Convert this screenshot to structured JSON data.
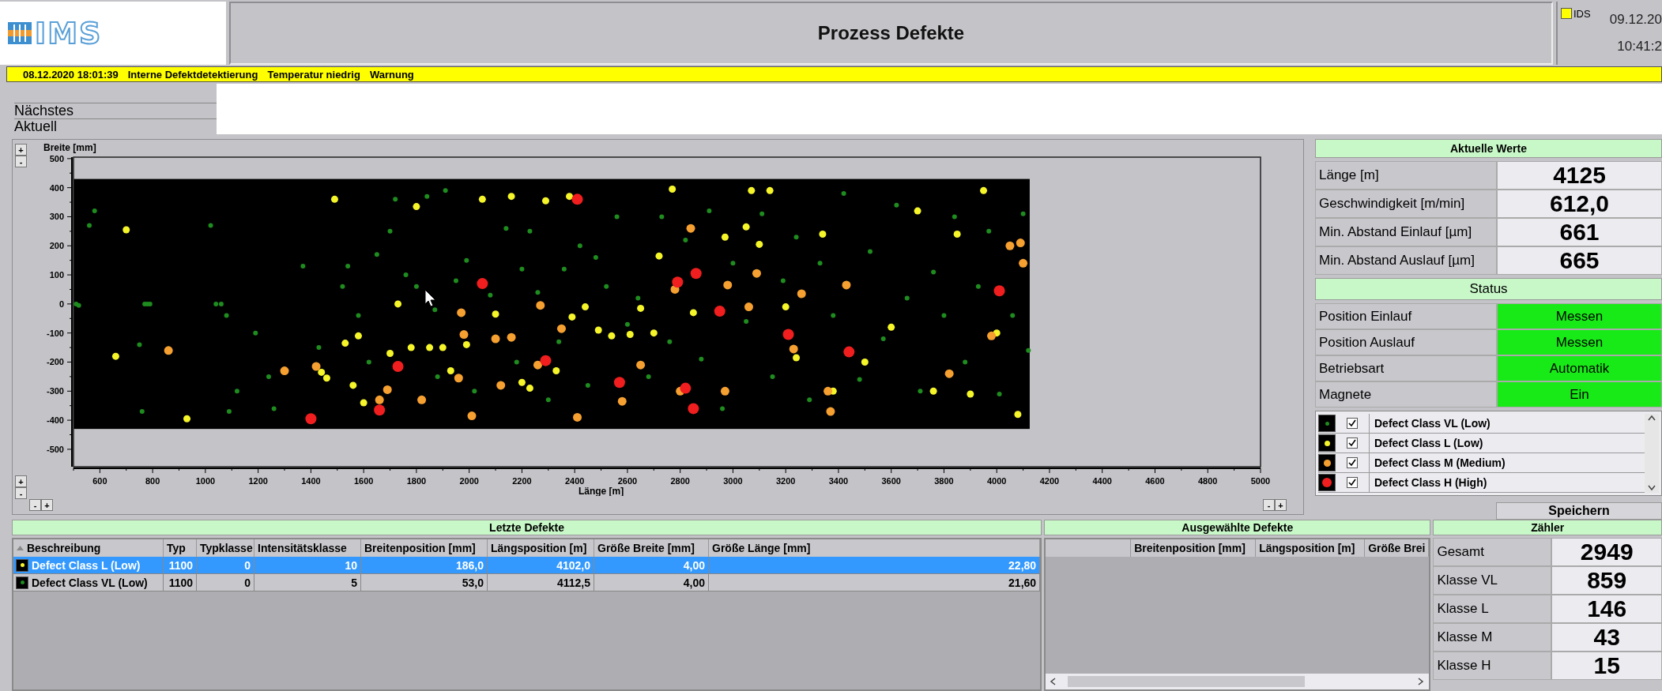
{
  "logo": {
    "text": "IMS"
  },
  "header": {
    "title": "Prozess Defekte",
    "indicator": {
      "label": "IDS",
      "on": true
    },
    "date": "09.12.20",
    "time": "10:41:2"
  },
  "alarm_bar": {
    "items": [
      "08.12.2020 18:01:39",
      "Interne Defektdetektierung",
      "Temperatur niedrig",
      "Warnung"
    ]
  },
  "schedule": {
    "rows": [
      "Nächstes",
      "Aktuell"
    ]
  },
  "chart": {
    "zoom_buttons": {
      "y_top": [
        "+",
        "-"
      ],
      "y_bottom": [
        "+",
        "-"
      ],
      "x_left": [
        "-",
        "+"
      ],
      "x_right": [
        "-",
        "+"
      ]
    },
    "chart_data": {
      "type": "scatter",
      "xlabel": "Länge [m]",
      "ylabel": "Breite [mm]",
      "xlim": [
        500,
        5000
      ],
      "ylim": [
        -560,
        505
      ],
      "xticks": [
        600,
        800,
        1000,
        1200,
        1400,
        1600,
        1800,
        2000,
        2200,
        2400,
        2600,
        2800,
        3000,
        3200,
        3400,
        3600,
        3800,
        4000,
        4200,
        4400,
        4600,
        4800,
        5000
      ],
      "yticks": [
        -500,
        -400,
        -300,
        -200,
        -100,
        0,
        100,
        200,
        300,
        400,
        500
      ],
      "bands": [
        {
          "axis": "y",
          "from": 430,
          "to": 505
        },
        {
          "axis": "y",
          "from": -560,
          "to": -430
        },
        {
          "axis": "x",
          "from": 4125,
          "to": 5000
        }
      ],
      "series": [
        {
          "name": "Defect Class VL (Low)",
          "color": "#1e8c1e",
          "x": [
            510,
            520,
            560,
            580,
            750,
            760,
            770,
            780,
            790,
            1020,
            1040,
            1060,
            1080,
            1090,
            1120,
            1190,
            1240,
            1260,
            1370,
            1430,
            1520,
            1540,
            1580,
            1620,
            1650,
            1700,
            1720,
            1760,
            1800,
            1840,
            1870,
            1880,
            1910,
            1950,
            1990,
            2020,
            2080,
            2140,
            2180,
            2200,
            2230,
            2260,
            2300,
            2340,
            2360,
            2420,
            2450,
            2480,
            2520,
            2560,
            2600,
            2640,
            2680,
            2730,
            2760,
            2820,
            2880,
            2910,
            2960,
            3000,
            3050,
            3110,
            3150,
            3190,
            3240,
            3290,
            3330,
            3380,
            3420,
            3480,
            3520,
            3570,
            3620,
            3660,
            3710,
            3760,
            3800,
            3840,
            3880,
            3930,
            3970,
            4010,
            4060,
            4100,
            4120
          ],
          "values": [
            0,
            -5,
            270,
            320,
            -140,
            -370,
            0,
            0,
            0,
            270,
            0,
            0,
            -40,
            -370,
            -300,
            -100,
            -250,
            -360,
            130,
            -150,
            60,
            130,
            -40,
            -200,
            170,
            250,
            360,
            100,
            60,
            370,
            -20,
            -250,
            390,
            80,
            150,
            -300,
            30,
            260,
            -200,
            120,
            250,
            40,
            -330,
            -130,
            120,
            200,
            -280,
            160,
            60,
            300,
            -70,
            20,
            -250,
            300,
            -130,
            220,
            -190,
            320,
            -360,
            140,
            -60,
            310,
            -250,
            80,
            230,
            -330,
            140,
            -40,
            380,
            -260,
            180,
            -120,
            340,
            20,
            -300,
            110,
            -40,
            300,
            -200,
            60,
            250,
            -310,
            -40,
            310,
            -160
          ]
        },
        {
          "name": "Defect Class L (Low)",
          "color": "#f5f52a",
          "x": [
            660,
            700,
            930,
            1490,
            1440,
            1460,
            1530,
            1560,
            1580,
            1600,
            1700,
            1730,
            1780,
            1800,
            1850,
            1900,
            1930,
            1990,
            2050,
            2100,
            2160,
            2200,
            2230,
            2290,
            2330,
            2380,
            2390,
            2440,
            2490,
            2540,
            2610,
            2650,
            2700,
            2720,
            2770,
            2850,
            2970,
            3050,
            3070,
            3100,
            3140,
            3200,
            3240,
            3340,
            3380,
            3500,
            3600,
            3700,
            3760,
            3850,
            3900,
            3950,
            4000,
            4080
          ],
          "values": [
            -180,
            255,
            -395,
            360,
            -235,
            -255,
            -135,
            -280,
            -110,
            -340,
            -170,
            0,
            -150,
            335,
            -150,
            -150,
            -230,
            -140,
            360,
            -35,
            370,
            -270,
            -290,
            355,
            -230,
            370,
            -45,
            -10,
            -90,
            -110,
            -105,
            -15,
            -100,
            165,
            395,
            -30,
            230,
            265,
            390,
            205,
            390,
            -10,
            -185,
            240,
            -300,
            -200,
            -80,
            320,
            -300,
            240,
            -310,
            390,
            -100,
            -380
          ]
        },
        {
          "name": "Defect Class M (Medium)",
          "color": "#f5a030",
          "x": [
            860,
            1300,
            1420,
            1660,
            1690,
            1820,
            1960,
            1980,
            1970,
            2010,
            2100,
            2120,
            2160,
            2260,
            2270,
            2350,
            2410,
            2580,
            2650,
            2780,
            2800,
            2840,
            2970,
            2980,
            3060,
            3090,
            3230,
            3260,
            3360,
            3370,
            3430,
            3820,
            3980,
            4050,
            4100,
            4090
          ],
          "values": [
            -160,
            -230,
            -215,
            -330,
            -295,
            -330,
            -255,
            -105,
            -30,
            -385,
            -120,
            -280,
            -115,
            -210,
            -5,
            -85,
            -390,
            -335,
            -210,
            50,
            -300,
            260,
            -300,
            65,
            -10,
            105,
            -155,
            35,
            -300,
            -370,
            65,
            -240,
            -110,
            200,
            140,
            210
          ]
        },
        {
          "name": "Defect Class H (High)",
          "color": "#f01e1e",
          "x": [
            1400,
            1660,
            1730,
            2050,
            2290,
            2410,
            2570,
            2790,
            2820,
            2850,
            2860,
            2950,
            3210,
            3440,
            4010
          ],
          "values": [
            -395,
            -365,
            -215,
            70,
            -195,
            360,
            -270,
            75,
            -290,
            -360,
            105,
            -25,
            -105,
            -165,
            45
          ]
        }
      ]
    }
  },
  "current_values": {
    "title": "Aktuelle Werte",
    "rows": [
      {
        "label": "Länge [m]",
        "value": "4125"
      },
      {
        "label": "Geschwindigkeit [m/min]",
        "value": "612,0"
      },
      {
        "label": "Min. Abstand Einlauf [µm]",
        "value": "661"
      },
      {
        "label": "Min. Abstand Auslauf [µm]",
        "value": "665"
      }
    ]
  },
  "status": {
    "title": "Status",
    "rows": [
      {
        "label": "Position Einlauf",
        "value": "Messen",
        "on": true
      },
      {
        "label": "Position Auslauf",
        "value": "Messen",
        "on": true
      },
      {
        "label": "Betriebsart",
        "value": "Automatik",
        "on": true
      },
      {
        "label": "Magnete",
        "value": "Ein",
        "on": true
      }
    ]
  },
  "legend": [
    {
      "checked": true
    },
    {
      "checked": true
    },
    {
      "checked": true
    },
    {
      "checked": true
    }
  ],
  "save_button": "Speichern",
  "last_defects": {
    "title": "Letzte Defekte",
    "columns": [
      "Beschreibung",
      "Typ",
      "Typklasse",
      "Intensitätsklasse",
      "Breitenposition [mm]",
      "Längsposition [m]",
      "Größe Breite [mm]",
      "Größe Länge [mm]"
    ],
    "rows": [
      {
        "color": "#f5f52a",
        "selected": true,
        "cells": [
          "Defect Class L (Low)",
          "1100",
          "0",
          "10",
          "186,0",
          "4102,0",
          "4,00",
          "22,80"
        ]
      },
      {
        "color": "#1e8c1e",
        "selected": false,
        "cells": [
          "Defect Class VL (Low)",
          "1100",
          "0",
          "5",
          "53,0",
          "4112,5",
          "4,00",
          "21,60"
        ]
      }
    ]
  },
  "selected_defects": {
    "title": "Ausgewählte Defekte",
    "columns": [
      "Breitenposition [mm]",
      "Längsposition [m]",
      "Größe Brei"
    ]
  },
  "counter": {
    "title": "Zähler",
    "rows": [
      {
        "label": "Gesamt",
        "value": "2949"
      },
      {
        "label": "Klasse VL",
        "value": "859"
      },
      {
        "label": "Klasse L",
        "value": "146"
      },
      {
        "label": "Klasse M",
        "value": "43"
      },
      {
        "label": "Klasse H",
        "value": "15"
      }
    ]
  }
}
